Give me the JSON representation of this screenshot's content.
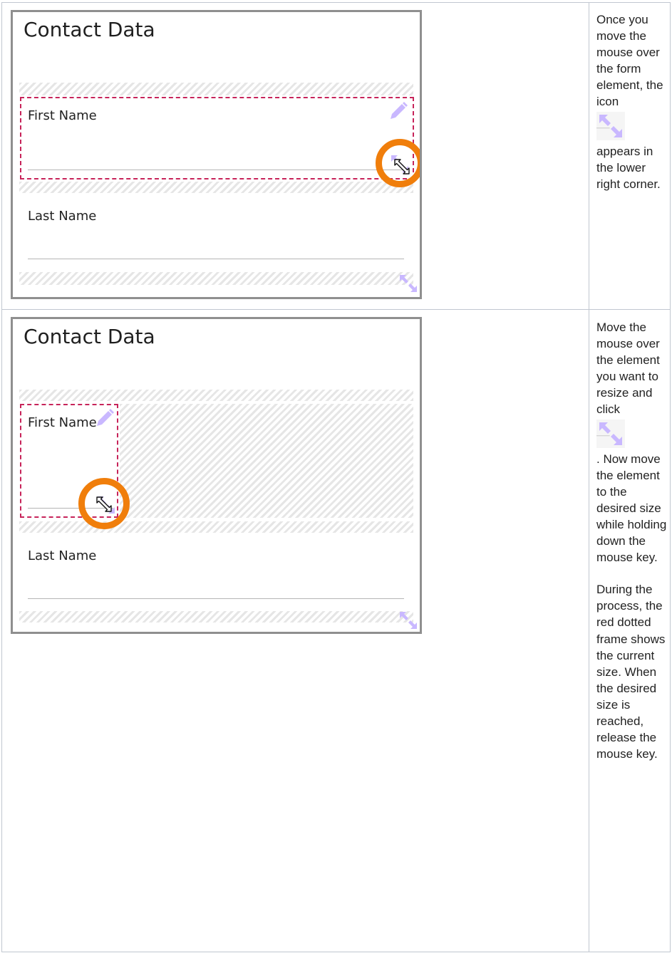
{
  "rows": [
    {
      "screenshot": {
        "title": "Contact Data",
        "fields": [
          "First Name",
          "Last Name"
        ]
      },
      "description": {
        "part1": "Once you move the mouse over the form element, the icon",
        "icon": "resize-icon",
        "part2": "appears in the lower right corner."
      }
    },
    {
      "screenshot": {
        "title": "Contact Data",
        "fields": [
          "First Name",
          "Last Name"
        ]
      },
      "description": {
        "part1": "Move the mouse over the element you want to resize and click",
        "icon": "resize-icon",
        "part2": ". Now move the element to the desired size while holding down the mouse key.",
        "part3": "During the process, the red dotted frame shows the current size. When the desired size is reached, release the mouse key."
      }
    }
  ],
  "colors": {
    "frame": "#c7245a",
    "highlight": "#f07e0b",
    "icon": "#c9b8ff",
    "table_border": "#c1c7d0"
  }
}
